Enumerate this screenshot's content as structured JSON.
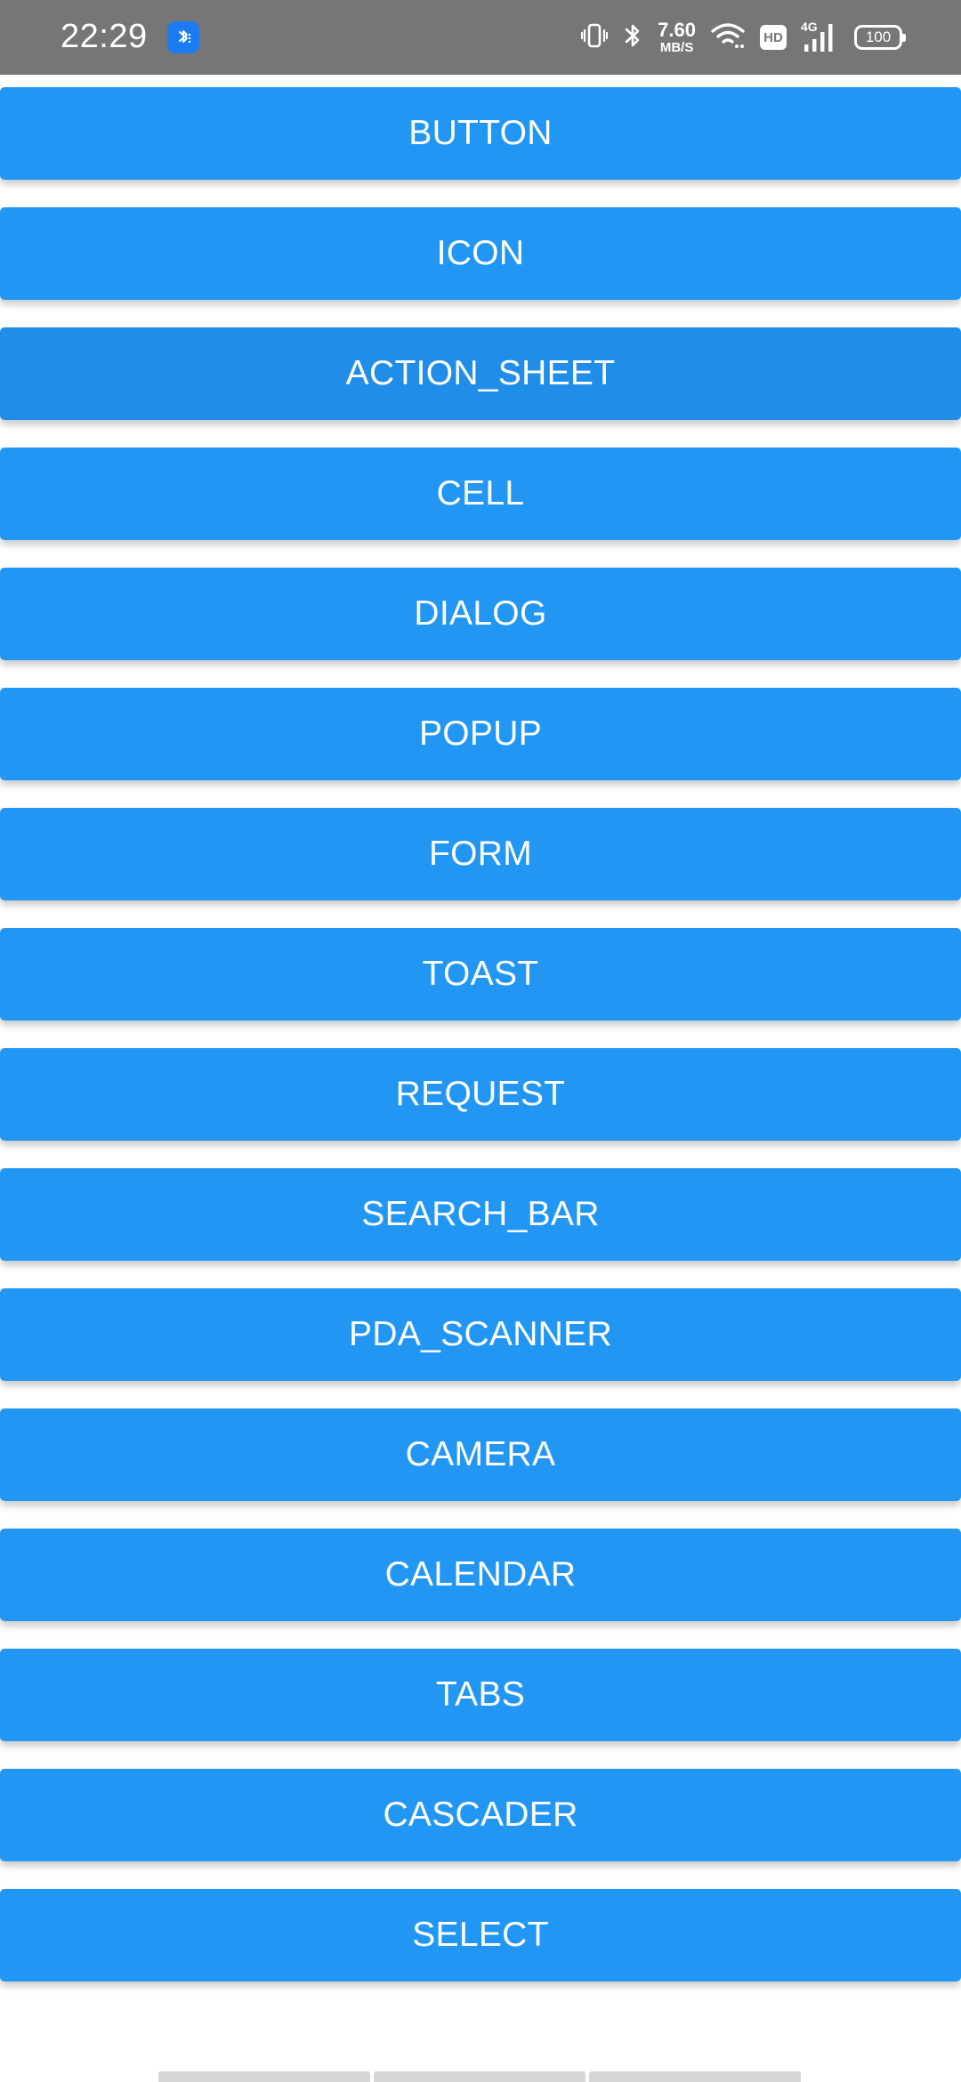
{
  "status_bar": {
    "time": "22:29",
    "app_icon": "bluetooth-app-icon",
    "icons": [
      "vibrate-icon",
      "bluetooth-icon",
      "wifi-icon",
      "cellular-signal-icon",
      "battery-icon"
    ],
    "speed_value": "7.60",
    "speed_unit": "MB/S",
    "hd_label": "HD",
    "network_type": "4G",
    "battery_level": "100",
    "bar_color": "#767676"
  },
  "menu": {
    "button_color": "#2196f3",
    "items": [
      {
        "label": "BUTTON"
      },
      {
        "label": "ICON"
      },
      {
        "label": "ACTION_SHEET"
      },
      {
        "label": "CELL"
      },
      {
        "label": "DIALOG"
      },
      {
        "label": "POPUP"
      },
      {
        "label": "FORM"
      },
      {
        "label": "TOAST"
      },
      {
        "label": "REQUEST"
      },
      {
        "label": "SEARCH_BAR"
      },
      {
        "label": "PDA_SCANNER"
      },
      {
        "label": "CAMERA"
      },
      {
        "label": "CALENDAR"
      },
      {
        "label": "TABS"
      },
      {
        "label": "CASCADER"
      },
      {
        "label": "SELECT"
      }
    ]
  }
}
